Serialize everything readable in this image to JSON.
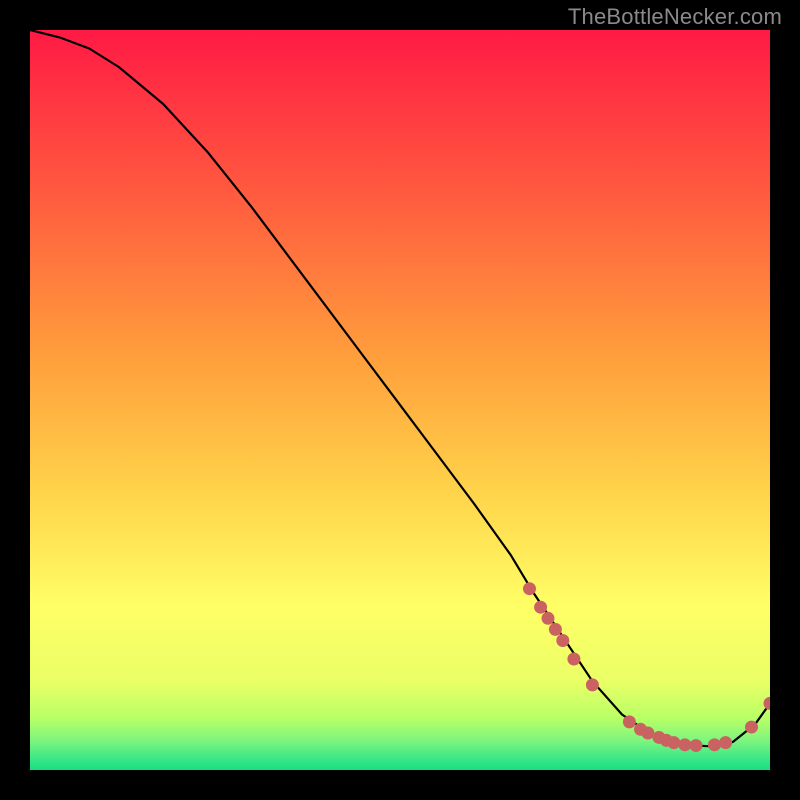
{
  "attribution": "TheBottleNecker.com",
  "colors": {
    "curve": "#000000",
    "marker": "#cb6262",
    "black": "#000000",
    "gradient_top": "#ff1a44",
    "gradient_mid1": "#ff7a3a",
    "gradient_mid2": "#ffd24a",
    "gradient_mid3": "#ffff66",
    "gradient_bottom": "#18e07a"
  },
  "chart_data": {
    "type": "line",
    "title": "",
    "xlabel": "",
    "ylabel": "",
    "xlim": [
      0,
      100
    ],
    "ylim": [
      0,
      100
    ],
    "grid": false,
    "series": [
      {
        "name": "bottleneck-curve",
        "x": [
          0,
          4,
          8,
          12,
          18,
          24,
          30,
          36,
          42,
          48,
          54,
          60,
          65,
          68,
          72,
          76,
          80,
          84,
          88,
          92,
          95,
          98,
          100
        ],
        "y": [
          100,
          99,
          97.5,
          95,
          90,
          83.5,
          76,
          68,
          60,
          52,
          44,
          36,
          29,
          24,
          18,
          12,
          7.5,
          4.8,
          3.4,
          3.2,
          3.8,
          6.2,
          9
        ]
      }
    ],
    "markers": {
      "name": "highlighted-points",
      "points": [
        {
          "x": 67.5,
          "y": 24.5
        },
        {
          "x": 69.0,
          "y": 22.0
        },
        {
          "x": 70.0,
          "y": 20.5
        },
        {
          "x": 71.0,
          "y": 19.0
        },
        {
          "x": 72.0,
          "y": 17.5
        },
        {
          "x": 73.5,
          "y": 15.0
        },
        {
          "x": 76.0,
          "y": 11.5
        },
        {
          "x": 81.0,
          "y": 6.5
        },
        {
          "x": 82.5,
          "y": 5.5
        },
        {
          "x": 83.5,
          "y": 5.0
        },
        {
          "x": 85.0,
          "y": 4.4
        },
        {
          "x": 86.0,
          "y": 4.0
        },
        {
          "x": 87.0,
          "y": 3.7
        },
        {
          "x": 88.5,
          "y": 3.4
        },
        {
          "x": 90.0,
          "y": 3.3
        },
        {
          "x": 92.5,
          "y": 3.4
        },
        {
          "x": 94.0,
          "y": 3.7
        },
        {
          "x": 97.5,
          "y": 5.8
        },
        {
          "x": 100.0,
          "y": 9.0
        }
      ]
    }
  }
}
